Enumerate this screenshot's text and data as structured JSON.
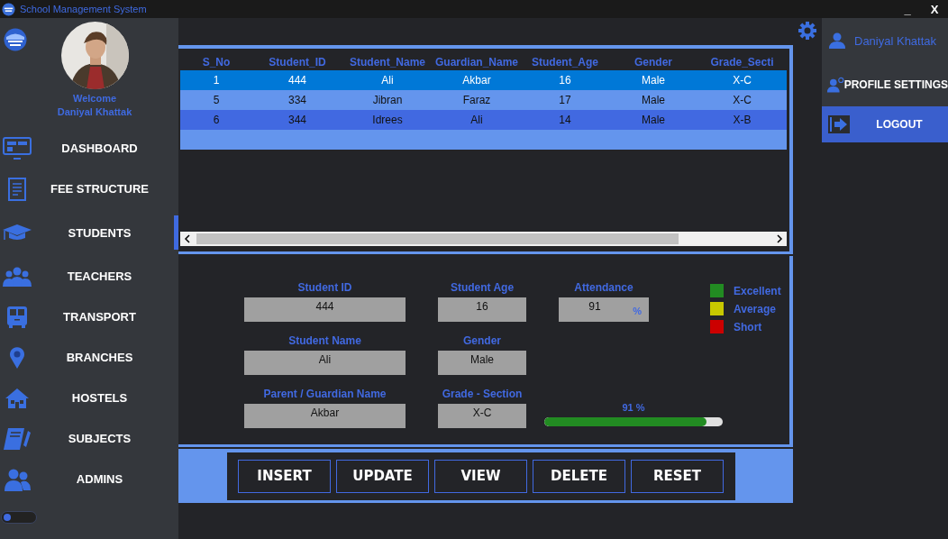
{
  "window": {
    "title": "School Management System",
    "minimize": "_",
    "close": "X"
  },
  "sidebar": {
    "welcome": "Welcome",
    "user": "Daniyal Khattak",
    "items": [
      {
        "label": "DASHBOARD",
        "selected": false
      },
      {
        "label": "FEE STRUCTURE",
        "selected": false
      },
      {
        "label": "STUDENTS",
        "selected": true
      },
      {
        "label": "TEACHERS",
        "selected": false
      },
      {
        "label": "TRANSPORT",
        "selected": false
      },
      {
        "label": "BRANCHES",
        "selected": false
      },
      {
        "label": "HOSTELS",
        "selected": false
      },
      {
        "label": "SUBJECTS",
        "selected": false
      },
      {
        "label": "ADMINS",
        "selected": false
      }
    ],
    "toggle": {
      "on": false
    }
  },
  "table": {
    "columns": [
      "S_No",
      "Student_ID",
      "Student_Name",
      "Guardian_Name",
      "Student_Age",
      "Gender",
      "Grade_Secti"
    ],
    "rows": [
      {
        "cells": [
          "1",
          "444",
          "Ali",
          "Akbar",
          "16",
          "Male",
          "X-C"
        ],
        "selected": true
      },
      {
        "cells": [
          "5",
          "334",
          "Jibran",
          "Faraz",
          "17",
          "Male",
          "X-C"
        ],
        "selected": false
      },
      {
        "cells": [
          "6",
          "344",
          "Idrees",
          "Ali",
          "14",
          "Male",
          "X-B"
        ],
        "selected": false
      }
    ]
  },
  "form": {
    "student_id": {
      "label": "Student ID",
      "value": "444"
    },
    "student_age": {
      "label": "Student Age",
      "value": "16"
    },
    "attendance": {
      "label": "Attendance",
      "value": "91",
      "unit": "%"
    },
    "student_name": {
      "label": "Student Name",
      "value": "Ali"
    },
    "gender": {
      "label": "Gender",
      "value": "Male"
    },
    "guardian_name": {
      "label": "Parent / Guardian Name",
      "value": "Akbar"
    },
    "grade_section": {
      "label": "Grade - Section",
      "value": "X-C"
    },
    "progress": {
      "reading": "91 %",
      "level": 0.91
    }
  },
  "legend": [
    {
      "label": "Excellent",
      "color": "#228b22"
    },
    {
      "label": "Average",
      "color": "#c8c800"
    },
    {
      "label": "Short",
      "color": "#cc0000"
    }
  ],
  "buttons": [
    "INSERT",
    "UPDATE",
    "VIEW",
    "DELETE",
    "RESET"
  ],
  "profile_menu": {
    "user": "Daniyal Khattak",
    "items": [
      {
        "label": "PROFILE SETTINGS",
        "selected": false
      },
      {
        "label": "LOGOUT",
        "selected": true
      }
    ]
  }
}
